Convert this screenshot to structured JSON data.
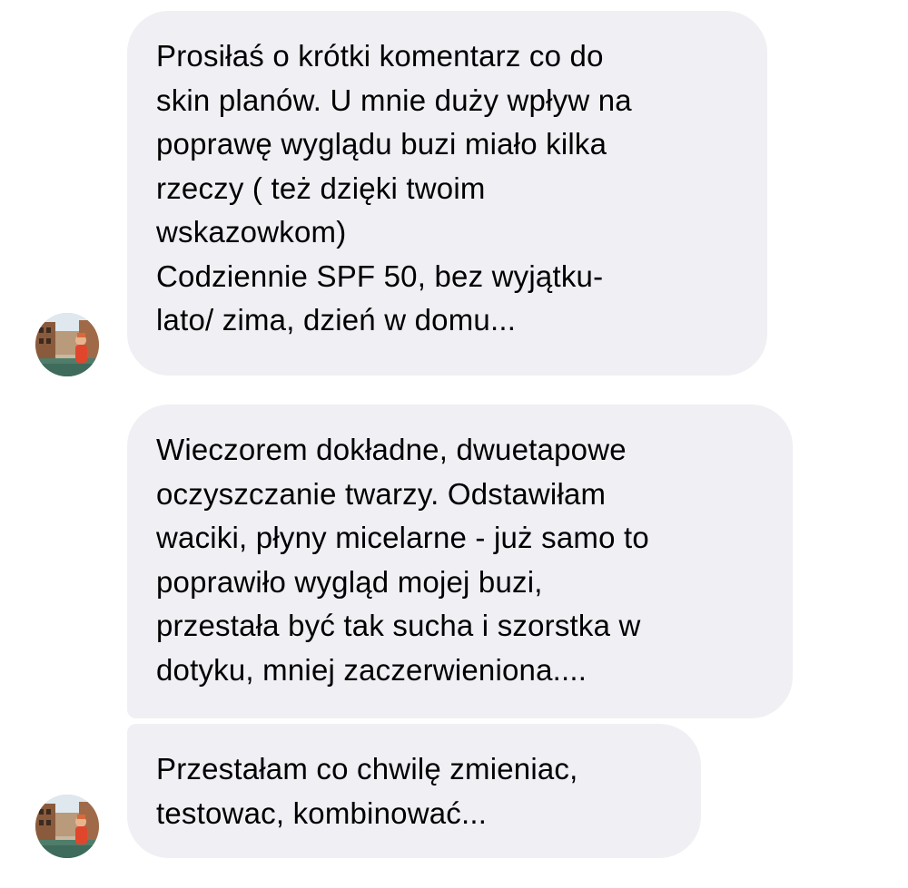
{
  "conversation": {
    "messages": [
      {
        "lines": [
          "Prosiłaś o krótki komentarz co do",
          "skin planów. U mnie duży wpływ na",
          "poprawę wyglądu buzi miało kilka",
          "rzeczy ( też dzięki twoim",
          "wskazowkom)",
          "Codziennie SPF 50, bez wyjątku-",
          "lato/ zima, dzień w domu..."
        ]
      },
      {
        "lines": [
          "Wieczorem dokładne, dwuetapowe",
          "oczyszczanie twarzy. Odstawiłam",
          "waciki, płyny micelarne - już samo to",
          "poprawiło wygląd mojej buzi,",
          "przestała być tak sucha i szorstka w",
          "dotyku, mniej zaczerwieniona...."
        ]
      },
      {
        "lines": [
          "Przestałam co chwilę zmieniac,",
          "testowac, kombinować..."
        ]
      }
    ]
  },
  "colors": {
    "bubble_background": "#efeff4",
    "text": "#000000",
    "page_background": "#ffffff"
  },
  "icons": {
    "avatar": "contact-avatar-photo"
  }
}
